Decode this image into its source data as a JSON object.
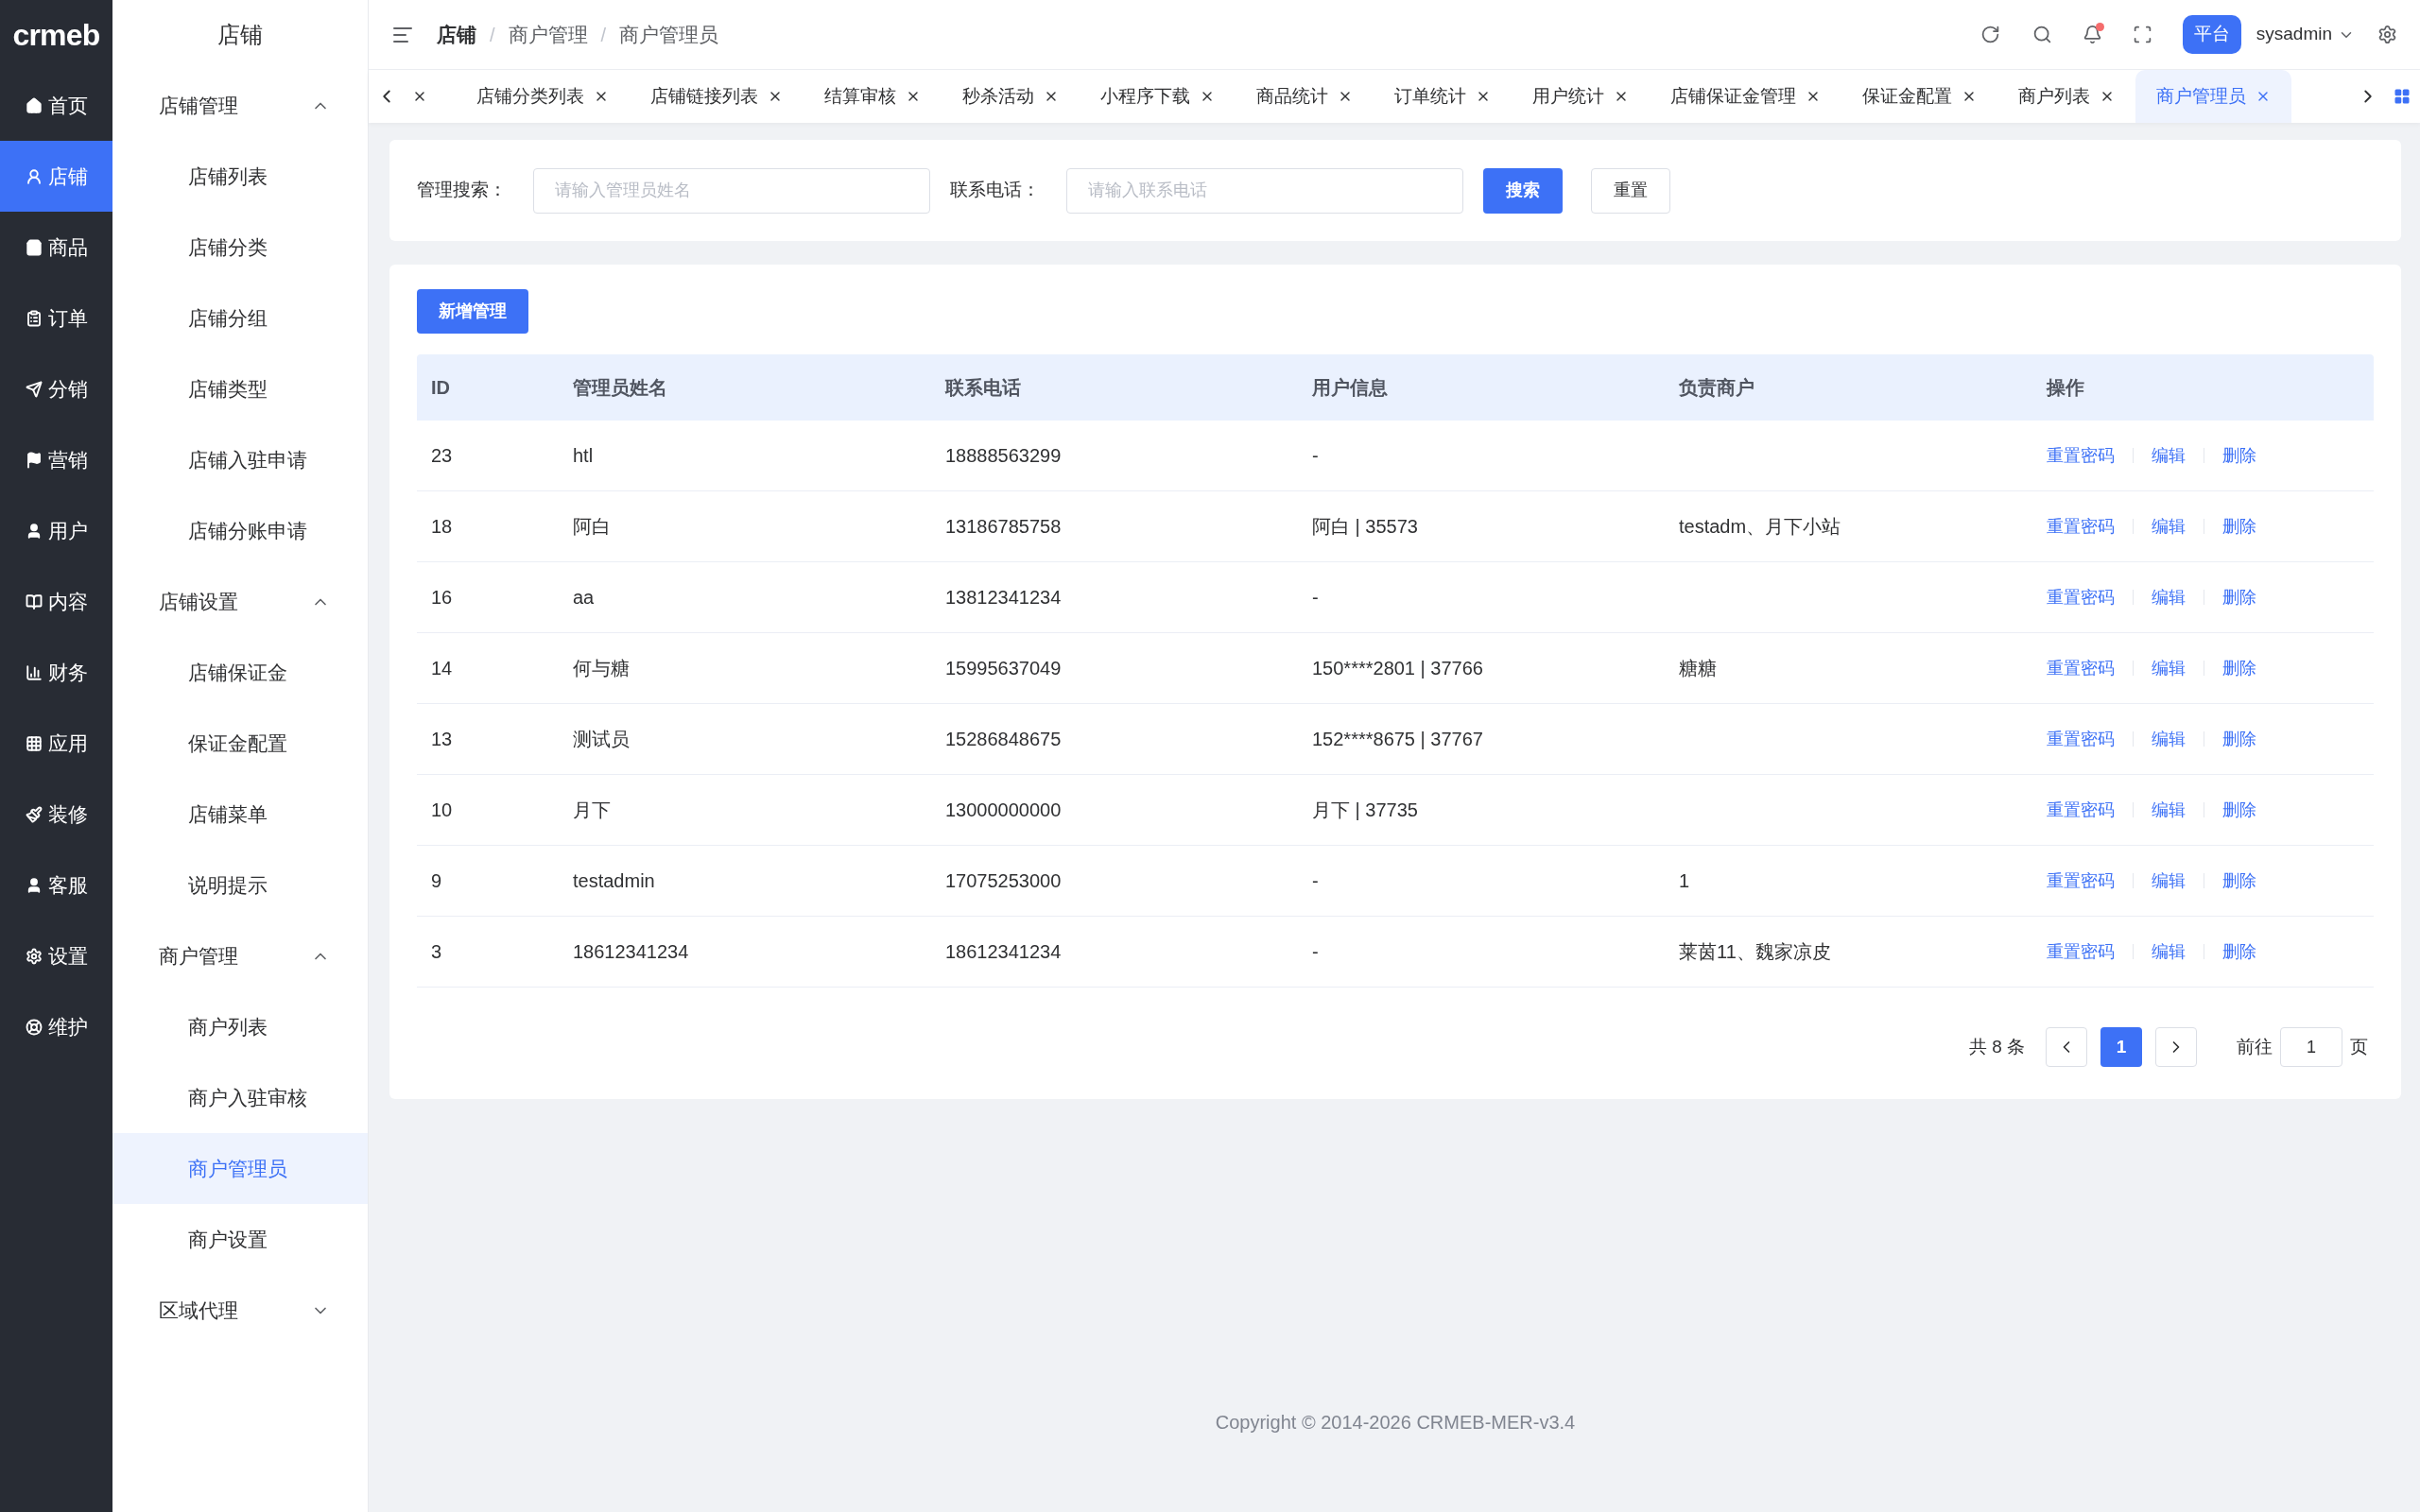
{
  "logo": "crmeb",
  "rail": [
    {
      "label": "首页",
      "selected": false
    },
    {
      "label": "店铺",
      "selected": true
    },
    {
      "label": "商品",
      "selected": false
    },
    {
      "label": "订单",
      "selected": false
    },
    {
      "label": "分销",
      "selected": false
    },
    {
      "label": "营销",
      "selected": false
    },
    {
      "label": "用户",
      "selected": false
    },
    {
      "label": "内容",
      "selected": false
    },
    {
      "label": "财务",
      "selected": false
    },
    {
      "label": "应用",
      "selected": false
    },
    {
      "label": "装修",
      "selected": false
    },
    {
      "label": "客服",
      "selected": false
    },
    {
      "label": "设置",
      "selected": false
    },
    {
      "label": "维护",
      "selected": false
    }
  ],
  "submenu": {
    "title": "店铺",
    "groups": [
      {
        "label": "店铺管理",
        "expanded": true,
        "children": [
          {
            "label": "店铺列表",
            "selected": false
          },
          {
            "label": "店铺分类",
            "selected": false
          },
          {
            "label": "店铺分组",
            "selected": false
          },
          {
            "label": "店铺类型",
            "selected": false
          },
          {
            "label": "店铺入驻申请",
            "selected": false
          },
          {
            "label": "店铺分账申请",
            "selected": false
          }
        ]
      },
      {
        "label": "店铺设置",
        "expanded": true,
        "children": [
          {
            "label": "店铺保证金",
            "selected": false
          },
          {
            "label": "保证金配置",
            "selected": false
          },
          {
            "label": "店铺菜单",
            "selected": false
          },
          {
            "label": "说明提示",
            "selected": false
          }
        ]
      },
      {
        "label": "商户管理",
        "expanded": true,
        "children": [
          {
            "label": "商户列表",
            "selected": false
          },
          {
            "label": "商户入驻审核",
            "selected": false
          },
          {
            "label": "商户管理员",
            "selected": true
          },
          {
            "label": "商户设置",
            "selected": false
          }
        ]
      },
      {
        "label": "区域代理",
        "expanded": false
      }
    ]
  },
  "header": {
    "breadcrumb": [
      "店铺",
      "商户管理",
      "商户管理员"
    ],
    "separator": "/",
    "notification": true,
    "role_badge": "平台",
    "user": "sysadmin"
  },
  "tabs": [
    {
      "selected": false
    },
    {
      "label": "店铺分类列表",
      "selected": false
    },
    {
      "label": "店铺链接列表",
      "selected": false
    },
    {
      "label": "结算审核",
      "selected": false
    },
    {
      "label": "秒杀活动",
      "selected": false
    },
    {
      "label": "小程序下载",
      "selected": false
    },
    {
      "label": "商品统计",
      "selected": false
    },
    {
      "label": "订单统计",
      "selected": false
    },
    {
      "label": "用户统计",
      "selected": false
    },
    {
      "label": "店铺保证金管理",
      "selected": false
    },
    {
      "label": "保证金配置",
      "selected": false
    },
    {
      "label": "商户列表",
      "selected": false
    },
    {
      "label": "商户管理员",
      "selected": true
    }
  ],
  "search": {
    "fields": [
      {
        "label": "管理搜索：",
        "placeholder": "请输入管理员姓名"
      },
      {
        "label": "联系电话：",
        "placeholder": "请输入联系电话"
      }
    ],
    "buttons": [
      {
        "label": "搜索",
        "kind": "primary"
      },
      {
        "label": "重置",
        "kind": "default"
      }
    ]
  },
  "add_button": "新增管理",
  "table": {
    "columns": [
      "ID",
      "管理员姓名",
      "联系电话",
      "用户信息",
      "负责商户",
      "操作"
    ],
    "rows": [
      {
        "cells": [
          "23",
          "htl",
          "18888563299",
          "-",
          ""
        ],
        "actions": [
          "重置密码",
          "编辑",
          "删除"
        ]
      },
      {
        "cells": [
          "18",
          "阿白",
          "13186785758",
          "阿白 | 35573",
          "testadm、月下小站"
        ],
        "actions": [
          "重置密码",
          "编辑",
          "删除"
        ]
      },
      {
        "cells": [
          "16",
          "aa",
          "13812341234",
          "-",
          ""
        ],
        "actions": [
          "重置密码",
          "编辑",
          "删除"
        ]
      },
      {
        "cells": [
          "14",
          "何与糖",
          "15995637049",
          "150****2801 | 37766",
          "糖糖"
        ],
        "actions": [
          "重置密码",
          "编辑",
          "删除"
        ]
      },
      {
        "cells": [
          "13",
          "测试员",
          "15286848675",
          "152****8675 | 37767",
          ""
        ],
        "actions": [
          "重置密码",
          "编辑",
          "删除"
        ]
      },
      {
        "cells": [
          "10",
          "月下",
          "13000000000",
          "月下 | 37735",
          ""
        ],
        "actions": [
          "重置密码",
          "编辑",
          "删除"
        ]
      },
      {
        "cells": [
          "9",
          "testadmin",
          "17075253000",
          "-",
          "1"
        ],
        "actions": [
          "重置密码",
          "编辑",
          "删除"
        ]
      },
      {
        "cells": [
          "3",
          "18612341234",
          "18612341234",
          "-",
          "莱茵11、魏家凉皮"
        ],
        "actions": [
          "重置密码",
          "编辑",
          "删除"
        ]
      }
    ]
  },
  "pagination": {
    "total": "共 8 条",
    "pages": [
      {
        "label": "1",
        "selected": true
      }
    ],
    "goto_label": "前往",
    "goto_value": "1",
    "suffix": "页"
  },
  "footer": "Copyright © 2014-2026 CRMEB-MER-v3.4"
}
